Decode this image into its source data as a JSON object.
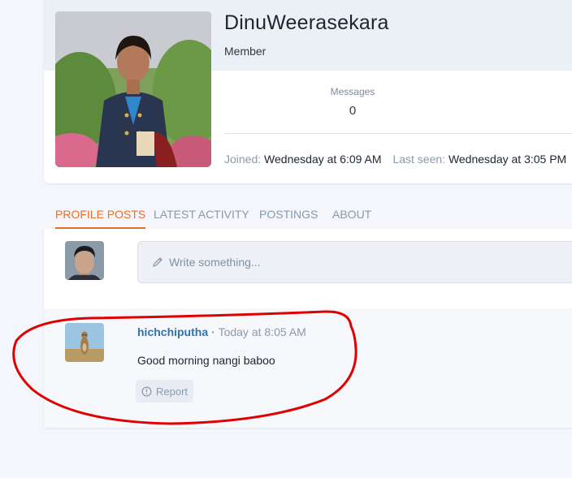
{
  "profile": {
    "username": "DinuWeerasekara",
    "title": "Member",
    "stats": {
      "messages_label": "Messages",
      "messages_value": "0"
    },
    "joined_label": "Joined:",
    "joined_value": "Wednesday at 6:09 AM",
    "last_seen_label": "Last seen:",
    "last_seen_value": "Wednesday at 3:05 PM"
  },
  "tabs": [
    {
      "label": "Profile posts",
      "active": true
    },
    {
      "label": "Latest activity",
      "active": false
    },
    {
      "label": "Postings",
      "active": false
    },
    {
      "label": "About",
      "active": false
    }
  ],
  "composer": {
    "placeholder": "Write something..."
  },
  "post": {
    "author": "hichchiputha",
    "separator": "·",
    "time": "Today at 8:05 AM",
    "body": "Good morning nangi baboo",
    "report_label": "Report"
  },
  "colors": {
    "accent": "#e2702e",
    "link": "#2b73b5",
    "annotation": "#e00000"
  },
  "icons": {
    "composer": "pencil-icon",
    "report": "exclamation-circle-icon"
  }
}
